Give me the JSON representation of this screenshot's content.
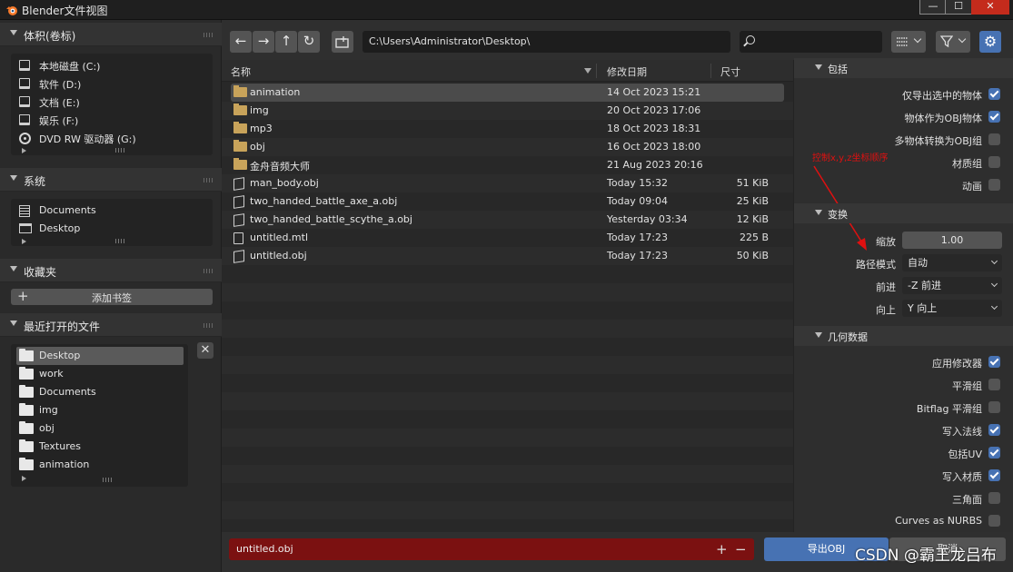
{
  "window": {
    "title": "Blender文件视图",
    "controls": [
      "—",
      "☐",
      "✕"
    ]
  },
  "sidebar": {
    "volumes": {
      "title": "体积(卷标)",
      "items": [
        {
          "label": "本地磁盘 (C:)",
          "icon": "drive-icon"
        },
        {
          "label": "软件 (D:)",
          "icon": "drive-icon"
        },
        {
          "label": "文档 (E:)",
          "icon": "drive-icon"
        },
        {
          "label": "娱乐 (F:)",
          "icon": "drive-icon"
        },
        {
          "label": "DVD RW 驱动器 (G:)",
          "icon": "disc-icon"
        }
      ]
    },
    "system": {
      "title": "系统",
      "items": [
        {
          "label": "Documents",
          "icon": "document-icon"
        },
        {
          "label": "Desktop",
          "icon": "desktop-icon"
        }
      ]
    },
    "bookmarks": {
      "title": "收藏夹",
      "add_label": "添加书签",
      "add_symbol": "+"
    },
    "recent": {
      "title": "最近打开的文件",
      "close_symbol": "✕",
      "items": [
        {
          "label": "Desktop",
          "selected": true
        },
        {
          "label": "work"
        },
        {
          "label": "Documents"
        },
        {
          "label": "img"
        },
        {
          "label": "obj"
        },
        {
          "label": "Textures"
        },
        {
          "label": "animation"
        }
      ]
    }
  },
  "toolbar": {
    "back_symbol": "←",
    "forward_symbol": "→",
    "parent_symbol": "↑",
    "refresh_symbol": "↻",
    "newfolder_symbol": "+",
    "path": "C:\\Users\\Administrator\\Desktop\\",
    "search_placeholder": "",
    "gear_symbol": "⚙"
  },
  "filelist": {
    "columns": {
      "name": "名称",
      "date": "修改日期",
      "size": "尺寸"
    },
    "rows": [
      {
        "name": "animation",
        "date": "14 Oct 2023 15:21",
        "size": "",
        "type": "folder",
        "selected": true
      },
      {
        "name": "img",
        "date": "20 Oct 2023 17:06",
        "size": "",
        "type": "folder"
      },
      {
        "name": "mp3",
        "date": "18 Oct 2023 18:31",
        "size": "",
        "type": "folder"
      },
      {
        "name": "obj",
        "date": "16 Oct 2023 18:00",
        "size": "",
        "type": "folder"
      },
      {
        "name": "金舟音频大师",
        "date": "21 Aug 2023 20:16",
        "size": "",
        "type": "folder"
      },
      {
        "name": "man_body.obj",
        "date": "Today 15:32",
        "size": "51 KiB",
        "type": "mesh"
      },
      {
        "name": "two_handed_battle_axe_a.obj",
        "date": "Today 09:04",
        "size": "25 KiB",
        "type": "mesh"
      },
      {
        "name": "two_handed_battle_scythe_a.obj",
        "date": "Yesterday 03:34",
        "size": "12 KiB",
        "type": "mesh"
      },
      {
        "name": "untitled.mtl",
        "date": "Today 17:23",
        "size": "225 B",
        "type": "text"
      },
      {
        "name": "untitled.obj",
        "date": "Today 17:23",
        "size": "50 KiB",
        "type": "mesh"
      }
    ]
  },
  "bottom": {
    "filename": "untitled.obj",
    "plus": "+",
    "minus": "−",
    "export_label": "导出OBJ",
    "cancel_label": "取消"
  },
  "options": {
    "include": {
      "title": "包括",
      "items": [
        {
          "label": "仅导出选中的物体",
          "checked": true
        },
        {
          "label": "物体作为OBJ物体",
          "checked": true
        },
        {
          "label": "多物体转换为OBJ组",
          "checked": false
        },
        {
          "label": "材质组",
          "checked": false
        },
        {
          "label": "动画",
          "checked": false
        }
      ]
    },
    "annotation": "控制x,y,z坐标顺序",
    "transform": {
      "title": "变换",
      "scale_label": "缩放",
      "scale_value": "1.00",
      "path_mode_label": "路径模式",
      "path_mode_value": "自动",
      "forward_label": "前进",
      "forward_value": "-Z 前进",
      "up_label": "向上",
      "up_value": "Y 向上"
    },
    "geometry": {
      "title": "几何数据",
      "items": [
        {
          "label": "应用修改器",
          "checked": true
        },
        {
          "label": "平滑组",
          "checked": false
        },
        {
          "label": "Bitflag 平滑组",
          "checked": false
        },
        {
          "label": "写入法线",
          "checked": true
        },
        {
          "label": "包括UV",
          "checked": true
        },
        {
          "label": "写入材质",
          "checked": true
        },
        {
          "label": "三角面",
          "checked": false
        },
        {
          "label": "Curves as NURBS",
          "checked": false
        }
      ]
    }
  },
  "watermark": "CSDN @霸王龙吕布",
  "colors": {
    "accent": "#4772b3",
    "filename_bg": "#7b1111",
    "folder": "#c8a35a",
    "annotation": "#e01010"
  }
}
